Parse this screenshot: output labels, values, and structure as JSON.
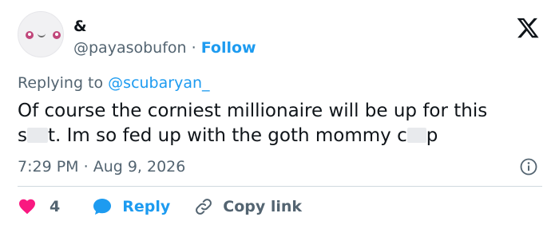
{
  "author": {
    "name": "&",
    "handle": "@payasobufon",
    "separator": "·",
    "follow_label": "Follow"
  },
  "reply_context": {
    "prefix": "Replying to",
    "mention": "@scubaryan_"
  },
  "tweet": {
    "line1": "Of course the corniest millionaire will be up for this",
    "line2_part1": "s",
    "line2_part2": "t. Im so fed up with the goth mommy c",
    "line2_part3": "p"
  },
  "meta": {
    "time": "7:29 PM",
    "separator": "·",
    "date": "Aug 9, 2026"
  },
  "actions": {
    "like_count": "4",
    "reply_label": "Reply",
    "copy_link_label": "Copy link"
  },
  "colors": {
    "accent": "#1d9bf0",
    "like": "#f91880",
    "muted": "#536471",
    "text": "#0f1419",
    "divider": "#cfd9de"
  },
  "icons": {
    "brand": "x-logo-icon",
    "info": "info-icon",
    "like": "heart-icon",
    "reply": "speech-bubble-icon",
    "copy": "link-icon"
  }
}
